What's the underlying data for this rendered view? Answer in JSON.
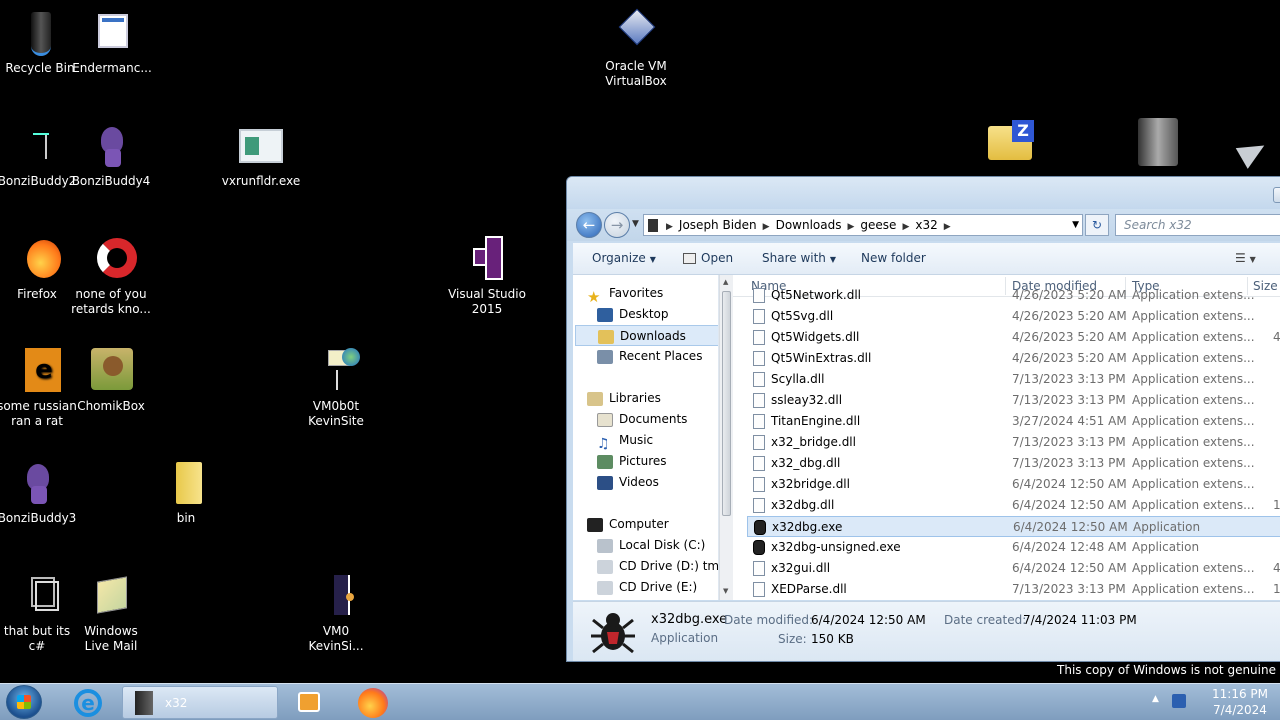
{
  "desktop": {
    "icons": [
      {
        "id": "recycle-bin",
        "label": "Recycle Bin"
      },
      {
        "id": "endermanch",
        "label": "Endermanc..."
      },
      {
        "id": "virtualbox",
        "label": "Oracle VM VirtualBox"
      },
      {
        "id": "bonzibuddy2",
        "label": "BonziBuddy2"
      },
      {
        "id": "bonzibuddy4",
        "label": "BonziBuddy4"
      },
      {
        "id": "vxrunfldr",
        "label": "vxrunfldr.exe"
      },
      {
        "id": "firefox",
        "label": "Firefox"
      },
      {
        "id": "none-of-you",
        "label": "none of you retards kno..."
      },
      {
        "id": "visual-studio",
        "label": "Visual Studio 2015"
      },
      {
        "id": "russian",
        "label": "some russian ran a rat"
      },
      {
        "id": "chomikbox",
        "label": "ChomikBox"
      },
      {
        "id": "vm0b0t",
        "label": "VM0b0t KevinSite"
      },
      {
        "id": "bonzibuddy3",
        "label": "BonziBuddy3"
      },
      {
        "id": "bin",
        "label": "bin"
      },
      {
        "id": "that-but",
        "label": "that but its c#"
      },
      {
        "id": "windows-live-mail",
        "label": "Windows Live Mail"
      },
      {
        "id": "vm0-kevinsi",
        "label": "VM0 KevinSi..."
      }
    ]
  },
  "explorer": {
    "breadcrumbs": [
      "Joseph Biden",
      "Downloads",
      "geese",
      "x32"
    ],
    "search_placeholder": "Search x32",
    "toolbar": {
      "organize": "Organize",
      "open": "Open",
      "share_with": "Share with",
      "new_folder": "New folder"
    },
    "nav": {
      "favorites": "Favorites",
      "desktop": "Desktop",
      "downloads": "Downloads",
      "recent_places": "Recent Places",
      "libraries": "Libraries",
      "documents": "Documents",
      "music": "Music",
      "pictures": "Pictures",
      "videos": "Videos",
      "computer": "Computer",
      "local_disk": "Local Disk (C:)",
      "cd_drive_d": "CD Drive (D:) tmp",
      "cd_drive_e": "CD Drive (E:)"
    },
    "columns": {
      "name": "Name",
      "date_modified": "Date modified",
      "type": "Type",
      "size": "Size"
    },
    "files": [
      {
        "name": "Qt5Network.dll",
        "date": "4/26/2023 5:20 AM",
        "type": "Application extens...",
        "size": ""
      },
      {
        "name": "Qt5Svg.dll",
        "date": "4/26/2023 5:20 AM",
        "type": "Application extens...",
        "size": ""
      },
      {
        "name": "Qt5Widgets.dll",
        "date": "4/26/2023 5:20 AM",
        "type": "Application extens...",
        "size": "4,"
      },
      {
        "name": "Qt5WinExtras.dll",
        "date": "4/26/2023 5:20 AM",
        "type": "Application extens...",
        "size": ""
      },
      {
        "name": "Scylla.dll",
        "date": "7/13/2023 3:13 PM",
        "type": "Application extens...",
        "size": ""
      },
      {
        "name": "ssleay32.dll",
        "date": "7/13/2023 3:13 PM",
        "type": "Application extens...",
        "size": ""
      },
      {
        "name": "TitanEngine.dll",
        "date": "3/27/2024 4:51 AM",
        "type": "Application extens...",
        "size": ""
      },
      {
        "name": "x32_bridge.dll",
        "date": "7/13/2023 3:13 PM",
        "type": "Application extens...",
        "size": ""
      },
      {
        "name": "x32_dbg.dll",
        "date": "7/13/2023 3:13 PM",
        "type": "Application extens...",
        "size": ""
      },
      {
        "name": "x32bridge.dll",
        "date": "6/4/2024 12:50 AM",
        "type": "Application extens...",
        "size": ""
      },
      {
        "name": "x32dbg.dll",
        "date": "6/4/2024 12:50 AM",
        "type": "Application extens...",
        "size": "1,"
      },
      {
        "name": "x32dbg.exe",
        "date": "6/4/2024 12:50 AM",
        "type": "Application",
        "size": "",
        "exe": true,
        "selected": true
      },
      {
        "name": "x32dbg-unsigned.exe",
        "date": "6/4/2024 12:48 AM",
        "type": "Application",
        "size": "",
        "exe": true
      },
      {
        "name": "x32gui.dll",
        "date": "6/4/2024 12:50 AM",
        "type": "Application extens...",
        "size": "4,"
      },
      {
        "name": "XEDParse.dll",
        "date": "7/13/2023 3:13 PM",
        "type": "Application extens...",
        "size": "1,"
      }
    ],
    "details": {
      "filename": "x32dbg.exe",
      "type": "Application",
      "date_modified_label": "Date modified:",
      "date_modified": "6/4/2024 12:50 AM",
      "date_created_label": "Date created:",
      "date_created": "7/4/2024 11:03 PM",
      "size_label": "Size:",
      "size": "150 KB"
    }
  },
  "taskbar": {
    "explorer_label": "x32",
    "time": "11:16 PM",
    "date": "7/4/2024"
  },
  "watermark": "This copy of Windows is not genuine"
}
